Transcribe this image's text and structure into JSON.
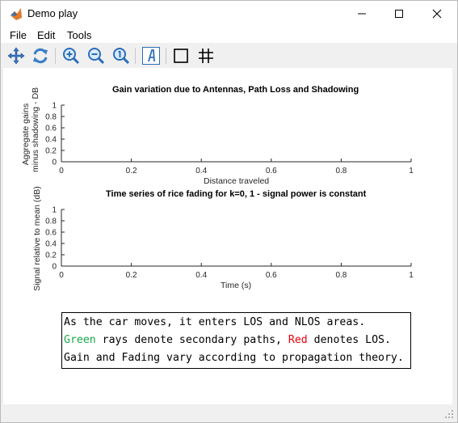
{
  "window": {
    "title": "Demo play"
  },
  "menu": {
    "items": [
      "File",
      "Edit",
      "Tools"
    ]
  },
  "toolbar": {
    "buttons": [
      "pan-icon",
      "rotate-icon",
      "zoom-in-icon",
      "zoom-out-icon",
      "zoom-reset-icon",
      "insert-text-icon",
      "insert-rectangle-icon",
      "toggle-grid-icon"
    ]
  },
  "chart_data": [
    {
      "type": "line",
      "title": "Gain variation due to Antennas, Path Loss and Shadowing",
      "xlabel": "Distance traveled",
      "ylabel_lines": [
        "Aggregate gains",
        "minus shadowing - DB"
      ],
      "xlim": [
        0,
        1
      ],
      "ylim": [
        0,
        1
      ],
      "xticks": [
        "0",
        "0.2",
        "0.4",
        "0.6",
        "0.8",
        "1"
      ],
      "yticks": [
        "0",
        "0.2",
        "0.4",
        "0.6",
        "0.8",
        "1"
      ],
      "series": [],
      "grid": false
    },
    {
      "type": "line",
      "title": "Time series of rice fading for k=0, 1 - signal power is constant",
      "xlabel": "Time (s)",
      "ylabel_lines": [
        "Signal relative to mean (dB)"
      ],
      "xlim": [
        0,
        1
      ],
      "ylim": [
        0,
        1
      ],
      "xticks": [
        "0",
        "0.2",
        "0.4",
        "0.6",
        "0.8",
        "1"
      ],
      "yticks": [
        "0",
        "0.2",
        "0.4",
        "0.6",
        "0.8",
        "1"
      ],
      "series": [],
      "grid": false
    }
  ],
  "legend_text": {
    "line1": "As the car moves, it enters LOS and NLOS areas.",
    "line2_green": "Green",
    "line2_mid": " rays denote secondary paths, ",
    "line2_red": "Red",
    "line2_end": " denotes LOS.",
    "line3": "Gain and Fading vary according to propagation theory."
  },
  "colors": {
    "green": "#1aa84a",
    "red": "#e8000b"
  }
}
